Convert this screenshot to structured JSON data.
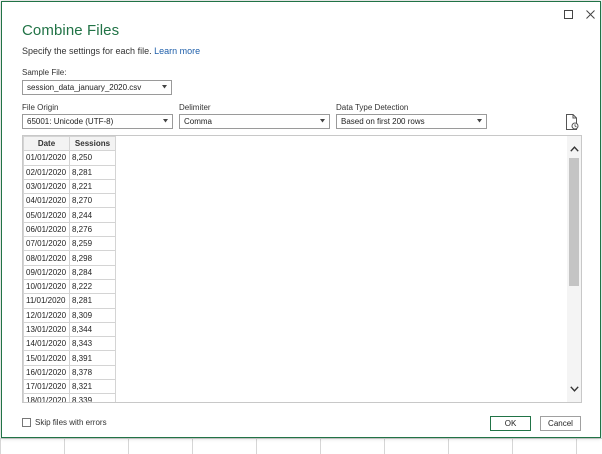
{
  "dialog": {
    "title": "Combine Files",
    "subtitle": "Specify the settings for each file.",
    "learn_more": "Learn more",
    "window_controls": {
      "maximize_icon": "maximize-icon",
      "close_icon": "close-icon"
    }
  },
  "sample_file": {
    "label": "Sample File:",
    "value": "session_data_january_2020.csv"
  },
  "file_origin": {
    "label": "File Origin",
    "value": "65001: Unicode (UTF-8)"
  },
  "delimiter": {
    "label": "Delimiter",
    "value": "Comma"
  },
  "data_type_detection": {
    "label": "Data Type Detection",
    "value": "Based on first 200 rows"
  },
  "preview": {
    "columns": [
      "Date",
      "Sessions"
    ],
    "rows": [
      [
        "01/01/2020",
        "8,250"
      ],
      [
        "02/01/2020",
        "8,281"
      ],
      [
        "03/01/2020",
        "8,221"
      ],
      [
        "04/01/2020",
        "8,270"
      ],
      [
        "05/01/2020",
        "8,244"
      ],
      [
        "06/01/2020",
        "8,276"
      ],
      [
        "07/01/2020",
        "8,259"
      ],
      [
        "08/01/2020",
        "8,298"
      ],
      [
        "09/01/2020",
        "8,284"
      ],
      [
        "10/01/2020",
        "8,222"
      ],
      [
        "11/01/2020",
        "8,281"
      ],
      [
        "12/01/2020",
        "8,309"
      ],
      [
        "13/01/2020",
        "8,344"
      ],
      [
        "14/01/2020",
        "8,343"
      ],
      [
        "15/01/2020",
        "8,391"
      ],
      [
        "16/01/2020",
        "8,378"
      ],
      [
        "17/01/2020",
        "8,321"
      ],
      [
        "18/01/2020",
        "8,339"
      ]
    ]
  },
  "skip_files": {
    "label": "Skip files with errors",
    "checked": false
  },
  "buttons": {
    "ok": "OK",
    "cancel": "Cancel"
  },
  "colors": {
    "accent": "#217346",
    "link": "#1f5faa"
  }
}
